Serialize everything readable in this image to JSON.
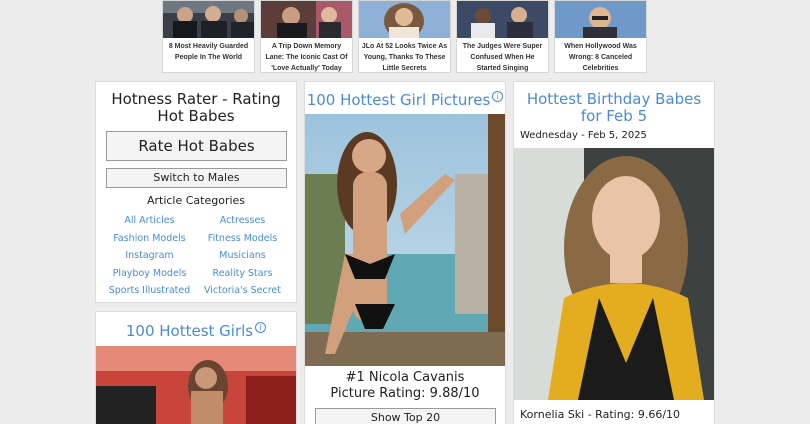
{
  "ads": [
    {
      "caption": "8 Most Heavily Guarded People In The World",
      "image": "men-in-suits-photo"
    },
    {
      "caption": "A Trip Down Memory Lane: The Iconic Cast Of 'Love Actually' Today",
      "image": "actors-photo"
    },
    {
      "caption": "JLo At 52 Looks Twice As Young, Thanks To These Little Secrets",
      "image": "singer-photo"
    },
    {
      "caption": "The Judges Were Super Confused When He Started Singing",
      "image": "judges-photo"
    },
    {
      "caption": "When Hollywood Was Wrong: 8 Canceled Celebrities",
      "image": "actor-photo"
    }
  ],
  "rater": {
    "title": "Hotness Rater - Rating Hot Babes",
    "rate_button": "Rate Hot Babes",
    "switch_button": "Switch to Males",
    "categories_heading": "Article Categories",
    "categories": [
      "All Articles",
      "Actresses",
      "Fashion Models",
      "Fitness Models",
      "Instagram",
      "Musicians",
      "Playboy Models",
      "Reality Stars",
      "Sports Illustrated",
      "Victoria's Secret"
    ]
  },
  "hottest_girls": {
    "title": "100 Hottest Girls",
    "info_icon": "i"
  },
  "girl_pictures": {
    "title": "100 Hottest Girl Pictures",
    "info_icon": "i",
    "rank_name": "#1 Nicola Cavanis",
    "rating": "Picture Rating: 9.88/10",
    "show_button": "Show Top 20"
  },
  "birthday": {
    "title": "Hottest Birthday Babes for Feb 5",
    "date": "Wednesday - Feb 5, 2025",
    "person_rating": "Kornelia Ski - Rating: 9.66/10"
  },
  "colors": {
    "background": "#ececec",
    "link_blue": "#4a8cd1",
    "panel": "#ffffff",
    "border": "#dcdcdc"
  }
}
